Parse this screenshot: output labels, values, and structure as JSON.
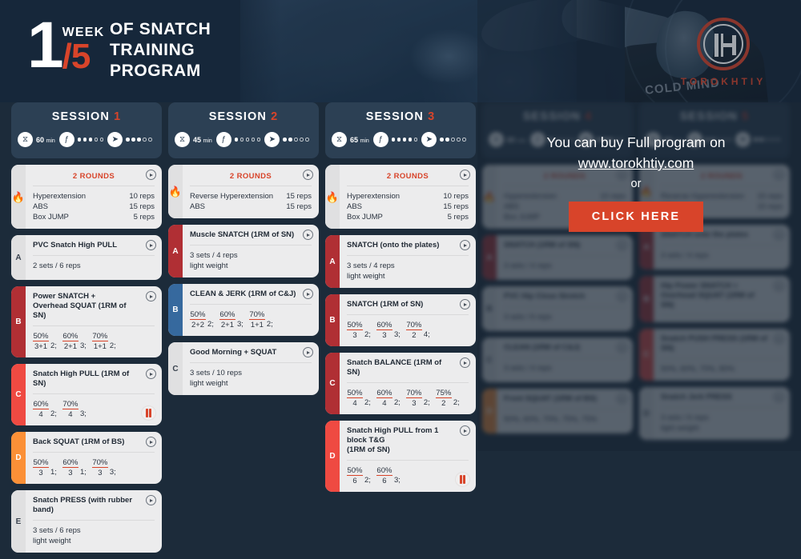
{
  "header": {
    "week_number": "1",
    "week_label": "WEEK",
    "week_total": "/5",
    "program_title": "OF SNATCH\nTRAINING\nPROGRAM",
    "program_title_lines": [
      "OF SNATCH",
      "TRAINING",
      "PROGRAM"
    ],
    "shirt_text": "COLD MIND",
    "logo_text": "TOROKHTIY",
    "accent_color": "#d8442a",
    "background_color": "#16273a"
  },
  "sessions": [
    {
      "title": "SESSION",
      "number": "1",
      "duration": "60",
      "duration_unit": "min",
      "strength_dots": 3,
      "intensity_dots": 2,
      "intensity_dots_filled": 3,
      "dots_total": 5,
      "locked": false,
      "warmup": {
        "rounds_label": "2 ROUNDS",
        "rows": [
          {
            "name": "Hyperextension",
            "reps": "10 reps"
          },
          {
            "name": "ABS",
            "reps": "15 reps"
          },
          {
            "name": "Box JUMP",
            "reps": "5 reps"
          }
        ]
      },
      "exercises": [
        {
          "letter": "A",
          "color": "gray",
          "title": "PVC Snatch High PULL",
          "sub": "2 sets / 6 reps",
          "sets": [],
          "straps": false
        },
        {
          "letter": "B",
          "color": "darkred",
          "title": "Power SNATCH +\nOverhead SQUAT (1RM of SN)",
          "sub": "",
          "sets": [
            {
              "pct": "50%",
              "reps": "3+1",
              "count": "2;"
            },
            {
              "pct": "60%",
              "reps": "2+1",
              "count": "3;"
            },
            {
              "pct": "70%",
              "reps": "1+1",
              "count": "2;"
            }
          ],
          "straps": false
        },
        {
          "letter": "C",
          "color": "red",
          "title": "Snatch High PULL (1RM of SN)",
          "sub": "",
          "sets": [
            {
              "pct": "60%",
              "reps": "4",
              "count": "2;"
            },
            {
              "pct": "70%",
              "reps": "4",
              "count": "3;"
            }
          ],
          "straps": true
        },
        {
          "letter": "D",
          "color": "orange",
          "title": "Back SQUAT (1RM of BS)",
          "sub": "",
          "sets": [
            {
              "pct": "50%",
              "reps": "3",
              "count": "1;"
            },
            {
              "pct": "60%",
              "reps": "3",
              "count": "1;"
            },
            {
              "pct": "70%",
              "reps": "3",
              "count": "3;"
            }
          ],
          "straps": false
        },
        {
          "letter": "E",
          "color": "gray",
          "title": "Snatch PRESS (with rubber band)",
          "sub": "3 sets / 6 reps\nlight weight",
          "sets": [],
          "straps": false
        }
      ]
    },
    {
      "title": "SESSION",
      "number": "2",
      "duration": "45",
      "duration_unit": "min",
      "strength_dots": 1,
      "intensity_dots_filled": 2,
      "dots_total": 5,
      "locked": false,
      "warmup": {
        "rounds_label": "2 ROUNDS",
        "rows": [
          {
            "name": "Reverse Hyperextension",
            "reps": "15 reps"
          },
          {
            "name": "ABS",
            "reps": "15 reps"
          }
        ]
      },
      "exercises": [
        {
          "letter": "A",
          "color": "darkred",
          "title": "Muscle SNATCH (1RM of SN)",
          "sub": "3 sets / 4 reps\nlight weight",
          "sets": [],
          "straps": false
        },
        {
          "letter": "B",
          "color": "blue",
          "title": "CLEAN & JERK (1RM of C&J)",
          "sub": "",
          "sets": [
            {
              "pct": "50%",
              "reps": "2+2",
              "count": "2;"
            },
            {
              "pct": "60%",
              "reps": "2+1",
              "count": "3;"
            },
            {
              "pct": "70%",
              "reps": "1+1",
              "count": "2;"
            }
          ],
          "straps": false
        },
        {
          "letter": "C",
          "color": "gray",
          "title": "Good Morning + SQUAT",
          "sub": "3 sets / 10 reps\nlight weight",
          "sets": [],
          "straps": false
        }
      ]
    },
    {
      "title": "SESSION",
      "number": "3",
      "duration": "65",
      "duration_unit": "min",
      "strength_dots": 4,
      "intensity_dots_filled": 2,
      "dots_total": 5,
      "locked": false,
      "warmup": {
        "rounds_label": "2 ROUNDS",
        "rows": [
          {
            "name": "Hyperextension",
            "reps": "10 reps"
          },
          {
            "name": "ABS",
            "reps": "15 reps"
          },
          {
            "name": "Box JUMP",
            "reps": "5 reps"
          }
        ]
      },
      "exercises": [
        {
          "letter": "A",
          "color": "darkred",
          "title": "SNATCH (onto the plates)",
          "sub": "3 sets / 4 reps\nlight weight",
          "sets": [],
          "straps": false
        },
        {
          "letter": "B",
          "color": "darkred",
          "title": "SNATCH (1RM of SN)",
          "sub": "",
          "sets": [
            {
              "pct": "50%",
              "reps": "3",
              "count": "2;"
            },
            {
              "pct": "60%",
              "reps": "3",
              "count": "3;"
            },
            {
              "pct": "70%",
              "reps": "2",
              "count": "4;"
            }
          ],
          "straps": false
        },
        {
          "letter": "C",
          "color": "darkred",
          "title": "Snatch BALANCE (1RM of SN)",
          "sub": "",
          "sets": [
            {
              "pct": "50%",
              "reps": "4",
              "count": "2;"
            },
            {
              "pct": "60%",
              "reps": "4",
              "count": "2;"
            },
            {
              "pct": "70%",
              "reps": "3",
              "count": "2;"
            },
            {
              "pct": "75%",
              "reps": "2",
              "count": "2;"
            }
          ],
          "straps": false
        },
        {
          "letter": "D",
          "color": "red",
          "title": "Snatch High PULL from 1 block T&G\n(1RM of SN)",
          "sub": "",
          "sets": [
            {
              "pct": "50%",
              "reps": "6",
              "count": "2;"
            },
            {
              "pct": "60%",
              "reps": "6",
              "count": "3;"
            }
          ],
          "straps": true
        }
      ]
    },
    {
      "title": "SESSION",
      "number": "4",
      "duration": "60",
      "duration_unit": "min",
      "strength_dots": 1,
      "intensity_dots_filled": 3,
      "dots_total": 5,
      "locked": true,
      "warmup": {
        "rounds_label": "2 ROUNDS",
        "rows": [
          {
            "name": "Hyperextension",
            "reps": "10 reps"
          },
          {
            "name": "ABS",
            "reps": "15 reps"
          },
          {
            "name": "Box JUMP",
            "reps": "5 reps"
          }
        ]
      },
      "exercises": [
        {
          "letter": "A",
          "color": "darkred",
          "title": "SNATCH (1RM of SN)",
          "sub": "3 sets / 4 reps",
          "sets": [],
          "straps": false
        },
        {
          "letter": "B",
          "color": "gray",
          "title": "PVC Hip Close Stretch",
          "sub": "3 sets / 6 reps",
          "sets": [],
          "straps": false
        },
        {
          "letter": "C",
          "color": "gray",
          "title": "CLEAN (1RM of C&J)",
          "sub": "3 sets / 4 reps",
          "sets": [],
          "straps": false
        },
        {
          "letter": "D",
          "color": "orange",
          "title": "Front SQUAT (1RM of BS)",
          "sub": "50%, 60%, 70%, 75%, 75%",
          "sets": [],
          "straps": false
        }
      ]
    },
    {
      "title": "SESSION",
      "number": "5",
      "duration": "60",
      "duration_unit": "min",
      "strength_dots": 2,
      "intensity_dots_filled": 2,
      "dots_total": 5,
      "locked": true,
      "warmup": {
        "rounds_label": "2 ROUNDS",
        "rows": [
          {
            "name": "Reverse Hyperextension",
            "reps": "15 reps"
          },
          {
            "name": "ABS",
            "reps": "15 reps"
          }
        ]
      },
      "exercises": [
        {
          "letter": "A",
          "color": "darkred",
          "title": "SNATCH onto the plates",
          "sub": "3 sets / 4 reps",
          "sets": [],
          "straps": false
        },
        {
          "letter": "B",
          "color": "darkred",
          "title": "Hip Power SNATCH + Overhead SQUAT (1RM of SN)",
          "sub": "",
          "sets": [],
          "straps": false
        },
        {
          "letter": "C",
          "color": "red",
          "title": "Snatch PUSH PRESS (1RM of SN)",
          "sub": "50%, 60%, 70%, 80%",
          "sets": [],
          "straps": false
        },
        {
          "letter": "D",
          "color": "gray",
          "title": "Snatch Jerk PRESS",
          "sub": "3 sets / 6 reps\nlight weight",
          "sets": [],
          "straps": false
        }
      ]
    }
  ],
  "cta": {
    "line1": "You can buy Full program on",
    "url": "www.torokhtiy.com",
    "or": "or",
    "button": "CLICK HERE",
    "button_color": "#d8442a"
  },
  "icons": {
    "timer": "hourglass-icon",
    "strength": "biceps-icon",
    "intensity": "rocket-icon",
    "warmup": "flame-icon",
    "video": "play-icon",
    "equipment": "straps-icon"
  }
}
